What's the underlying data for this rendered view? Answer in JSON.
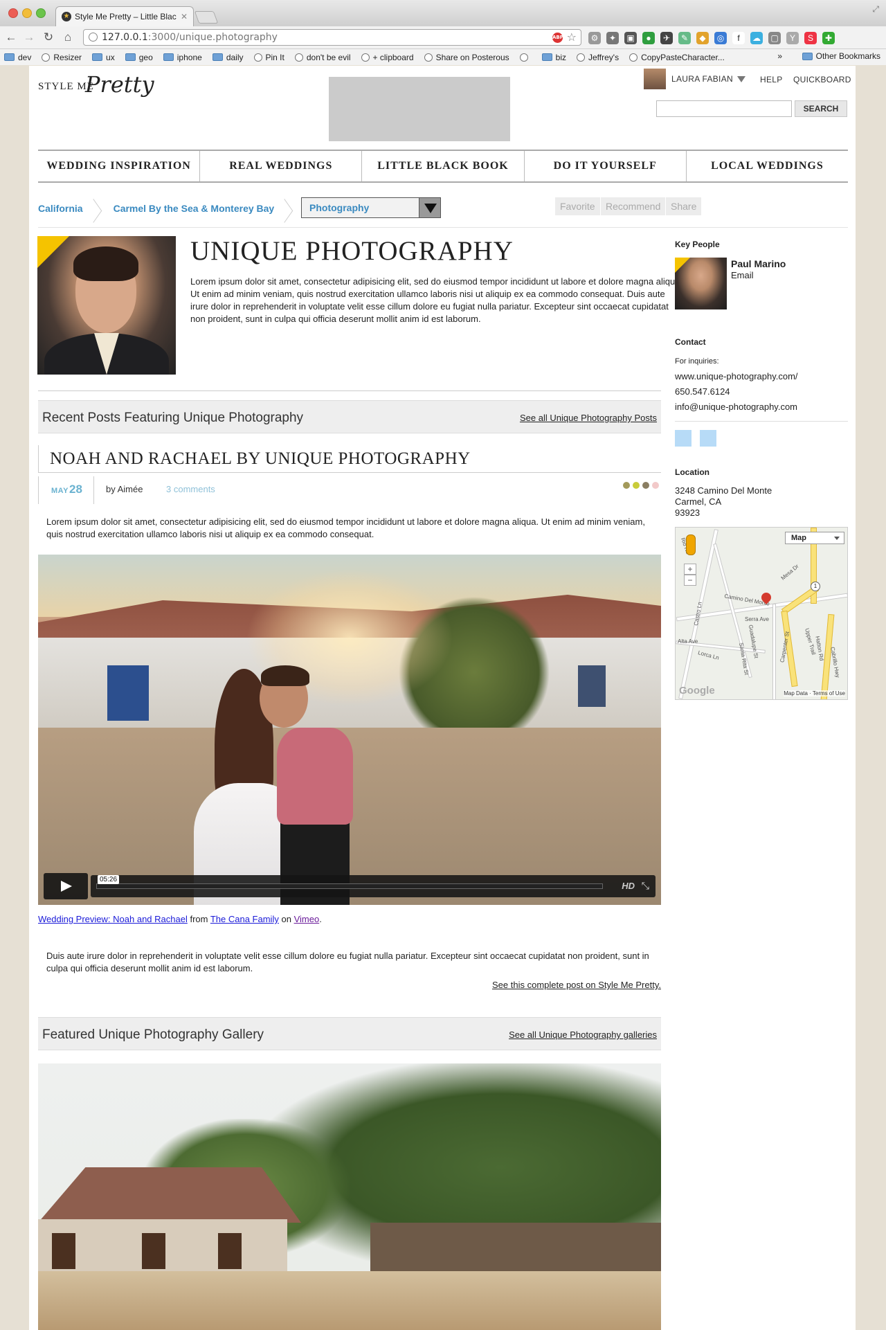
{
  "browser": {
    "tab_title": "Style Me Pretty – Little Black",
    "url_host": "127.0.0.1",
    "url_rest": ":3000/unique.photography",
    "bookmarks": [
      {
        "label": "dev",
        "kind": "folder"
      },
      {
        "label": "Resizer",
        "kind": "page"
      },
      {
        "label": "ux",
        "kind": "folder"
      },
      {
        "label": "geo",
        "kind": "folder"
      },
      {
        "label": "iphone",
        "kind": "folder"
      },
      {
        "label": "daily",
        "kind": "folder"
      },
      {
        "label": "Pin It",
        "kind": "page"
      },
      {
        "label": "don't be evil",
        "kind": "page"
      },
      {
        "label": "+ clipboard",
        "kind": "page"
      },
      {
        "label": "Share on Posterous",
        "kind": "page"
      },
      {
        "label": "",
        "kind": "page"
      },
      {
        "label": "biz",
        "kind": "folder"
      },
      {
        "label": "Jeffrey's",
        "kind": "page"
      },
      {
        "label": "CopyPasteCharacter...",
        "kind": "page"
      }
    ],
    "more": "»",
    "other_bookmarks": "Other Bookmarks"
  },
  "header": {
    "logo_small": "STYLE ME",
    "logo_script": "Pretty",
    "user_name": "LAURA FABIAN",
    "help": "HELP",
    "quickboard": "QUICKBOARD",
    "search_button": "SEARCH"
  },
  "nav": [
    "WEDDING INSPIRATION",
    "REAL WEDDINGS",
    "LITTLE BLACK BOOK",
    "DO IT YOURSELF",
    "LOCAL WEDDINGS"
  ],
  "breadcrumb": {
    "state": "California",
    "region": "Carmel By the Sea & Monterey Bay",
    "category": "Photography"
  },
  "actions": {
    "favorite": "Favorite",
    "recommend": "Recommend",
    "share": "Share"
  },
  "vendor": {
    "name": "UNIQUE PHOTOGRAPHY",
    "description": "Lorem ipsum dolor sit amet, consectetur adipisicing elit, sed do eiusmod tempor incididunt ut labore et dolore magna aliqua. Ut enim ad minim veniam, quis nostrud exercitation ullamco laboris nisi ut aliquip ex ea commodo consequat. Duis aute irure dolor in reprehenderit in voluptate velit esse cillum dolore eu fugiat nulla pariatur. Excepteur sint occaecat cupidatat non proident, sunt in culpa qui officia deserunt mollit anim id est laborum."
  },
  "recent_posts": {
    "title": "Recent Posts Featuring Unique Photography",
    "link": "See all Unique Photography Posts"
  },
  "post": {
    "title": "NOAH AND RACHAEL BY UNIQUE PHOTOGRAPHY",
    "month": "MAY",
    "day": "28",
    "by": "by Aimée",
    "comments": "3 comments",
    "swatch_colors": [
      "#a39a5a",
      "#c9cc3a",
      "#8a7e62",
      "#f2c9c9"
    ],
    "excerpt": "Lorem ipsum dolor sit amet, consectetur adipisicing elit, sed do eiusmod tempor incididunt ut labore et dolore magna aliqua. Ut enim ad minim veniam, quis nostrud exercitation ullamco laboris nisi ut aliquip ex ea commodo consequat.",
    "video_time": "05:26",
    "video_hd": "HD",
    "credit_video": "Wedding Preview: Noah and Rachael",
    "credit_from": "from",
    "credit_user": "The Cana Family",
    "credit_on": "on",
    "credit_site": "Vimeo",
    "credit_end": ".",
    "body": "Duis aute irure dolor in reprehenderit in voluptate velit esse cillum dolore eu fugiat nulla pariatur. Excepteur sint occaecat cupidatat non proident, sunt in culpa qui officia deserunt mollit anim id est laborum.",
    "see_post": "See this complete post on Style Me Pretty."
  },
  "gallery": {
    "title": "Featured Unique Photography Gallery",
    "link": "See all Unique Photography galleries"
  },
  "sidebar": {
    "key_people_label": "Key People",
    "person_name": "Paul Marino",
    "person_email": "Email",
    "contact_label": "Contact",
    "for_inquiries": "For inquiries:",
    "website": "www.unique-photography.com/",
    "phone": "650.547.6124",
    "email": "info@unique-photography.com",
    "location_label": "Location",
    "address_line1": "3248 Camino Del Monte",
    "address_line2": "Carmel, CA",
    "address_line3": "93923",
    "map_type": "Map",
    "map_brand": "Google",
    "map_terms": "Map Data · Terms of Use",
    "map_route": "1",
    "map_labels": [
      "Camino Del Monte",
      "Serra Ave",
      "Carpenter St",
      "Guadalupe St",
      "Santa Rita St",
      "Lorca Ln",
      "Castro Ln",
      "Upper Trail",
      "Hatton Rd",
      "Cabrillo Hwy",
      "Rio Rd",
      "Alta Ave",
      "Mesa Dr"
    ]
  },
  "colors": {
    "link_blue": "#3a8ac0",
    "date_blue": "#6ab2d0",
    "accent_yellow": "#f5c300",
    "page_bg": "#e6e0d4"
  }
}
